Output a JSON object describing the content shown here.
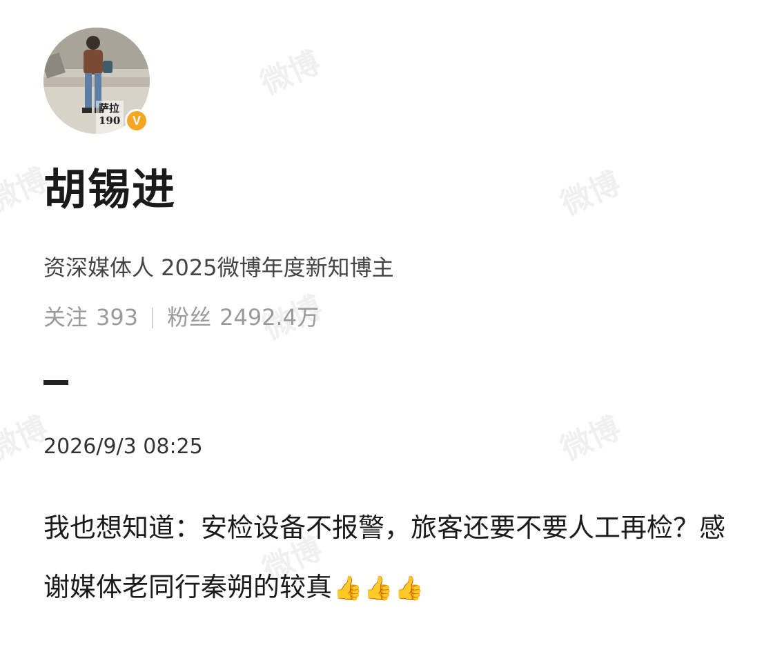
{
  "watermark_text": "微博",
  "profile": {
    "avatar_caption": "萨拉 190",
    "verified_badge": "V",
    "name": "胡锡进",
    "bio": "资深媒体人 2025微博年度新知博主",
    "following_label": "关注",
    "following_count": "393",
    "followers_label": "粉丝",
    "followers_count": "2492.4万"
  },
  "post": {
    "timestamp": "2026/9/3 08:25",
    "text": "我也想知道：安检设备不报警，旅客还要不要人工再检？感谢媒体老同行秦朔的较真",
    "emoji_icons": [
      "thumbs-up-icon",
      "thumbs-up-icon",
      "thumbs-up-icon"
    ],
    "emoji_glyph": "👍"
  },
  "colors": {
    "badge": "#f6a623",
    "text_primary": "#1a1a1a",
    "text_secondary": "#444444",
    "text_muted": "#9a9a9a"
  }
}
